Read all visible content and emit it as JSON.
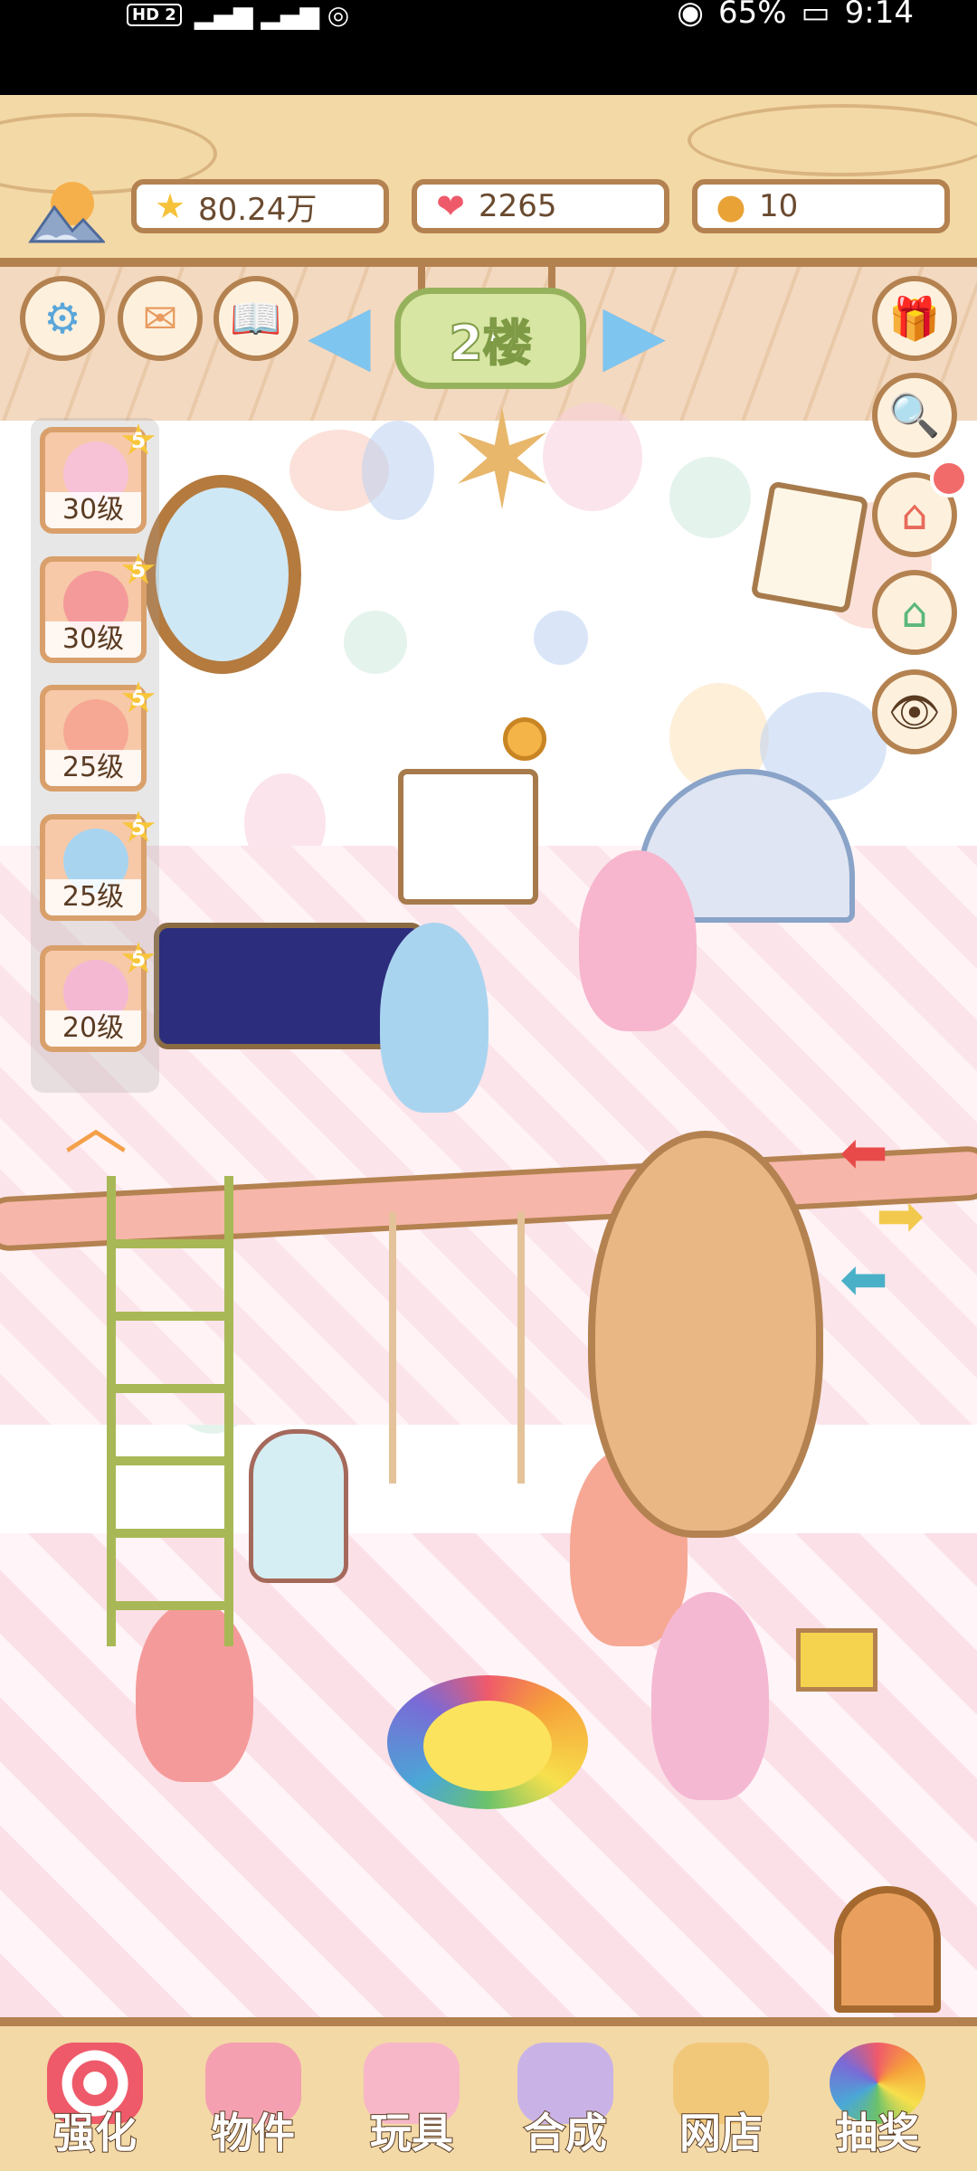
{
  "status_bar": {
    "network": "HD 2",
    "signal": "4G",
    "battery": "65%",
    "time": "9:14"
  },
  "resources": {
    "stars": "80.24万",
    "hearts": "2265",
    "coins": "10"
  },
  "floor": {
    "label": "2楼"
  },
  "characters": [
    {
      "level": "30级",
      "rank": "5"
    },
    {
      "level": "30级",
      "rank": "5"
    },
    {
      "level": "25级",
      "rank": "5"
    },
    {
      "level": "25级",
      "rank": "5"
    },
    {
      "level": "20级",
      "rank": "5"
    }
  ],
  "nav": [
    {
      "label": "强化",
      "icon": "lollipop-icon"
    },
    {
      "label": "物件",
      "icon": "piano-icon"
    },
    {
      "label": "玩具",
      "icon": "toy-house-icon"
    },
    {
      "label": "合成",
      "icon": "cards-icon"
    },
    {
      "label": "网店",
      "icon": "shop-cart-icon"
    },
    {
      "label": "抽奖",
      "icon": "wheel-icon"
    }
  ],
  "colors": {
    "wood": "#f3d9a6",
    "wood_border": "#b48250",
    "sign_green": "#d7e6a3",
    "arrow_blue": "#7ec6f0"
  }
}
